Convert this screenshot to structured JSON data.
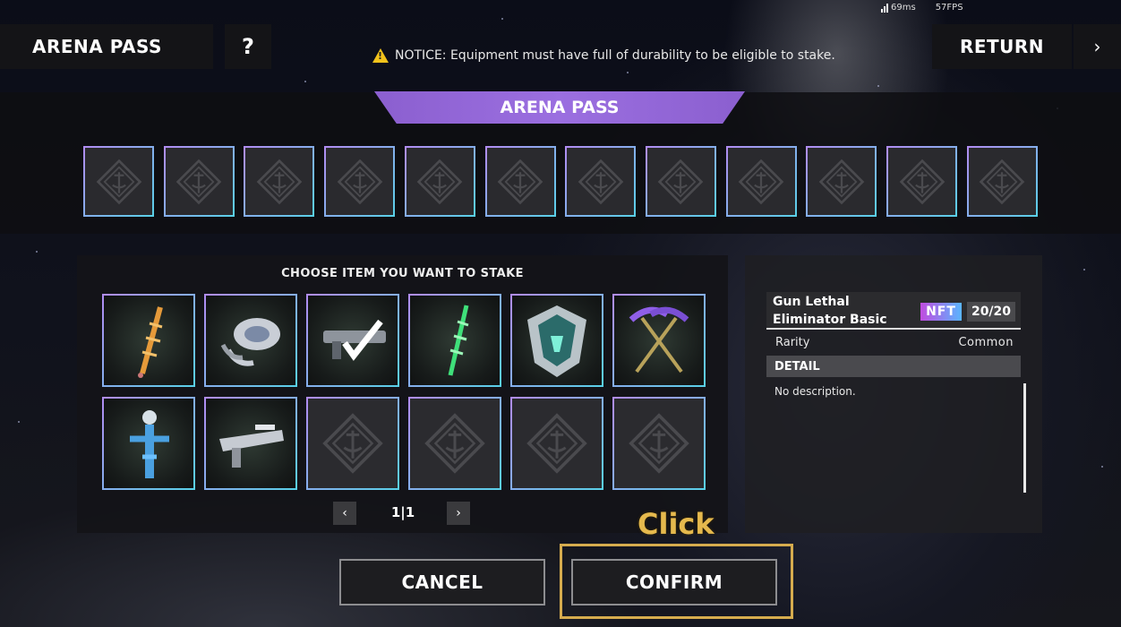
{
  "header": {
    "title": "ARENA PASS",
    "help_label": "?",
    "notice": "NOTICE: Equipment must have full of durability to be eligible to stake.",
    "return_label": "RETURN",
    "next_label": "›"
  },
  "status": {
    "ping": "69ms",
    "fps": "57FPS"
  },
  "pass": {
    "banner": "ARENA PASS",
    "slots": [
      "empty",
      "empty",
      "empty",
      "empty",
      "empty",
      "empty",
      "empty",
      "empty",
      "empty",
      "empty",
      "empty",
      "empty"
    ]
  },
  "choose": {
    "title": "CHOOSE ITEM YOU WANT TO STAKE",
    "items": [
      {
        "icon": "orange-sword-icon",
        "filled": true
      },
      {
        "icon": "silver-gauntlet-icon",
        "filled": true
      },
      {
        "icon": "rifle-selected-icon",
        "filled": true
      },
      {
        "icon": "green-sword-icon",
        "filled": true
      },
      {
        "icon": "shield-armor-icon",
        "filled": true
      },
      {
        "icon": "purple-scythes-icon",
        "filled": true
      },
      {
        "icon": "blue-spirit-figure-icon",
        "filled": true
      },
      {
        "icon": "silver-rifle-icon",
        "filled": true
      },
      {
        "icon": "empty-slot-icon",
        "filled": false
      },
      {
        "icon": "empty-slot-icon",
        "filled": false
      },
      {
        "icon": "empty-slot-icon",
        "filled": false
      },
      {
        "icon": "empty-slot-icon",
        "filled": false
      }
    ],
    "pager": {
      "prev": "‹",
      "text": "1|1",
      "next": "›"
    }
  },
  "detail": {
    "name": "Gun Lethal Eliminator Basic",
    "nft_badge": "NFT",
    "durability": "20/20",
    "rarity_label": "Rarity",
    "rarity_value": "Common",
    "detail_heading": "DETAIL",
    "description": "No description."
  },
  "actions": {
    "cancel_label": "CANCEL",
    "confirm_label": "CONFIRM",
    "click_hint": "Click"
  },
  "colors": {
    "accent_purple": "#9b6fe0",
    "slot_border_start": "#b18cf2",
    "slot_border_end": "#59d0e8",
    "highlight": "#d6ac4e",
    "warning": "#f2c21b"
  }
}
